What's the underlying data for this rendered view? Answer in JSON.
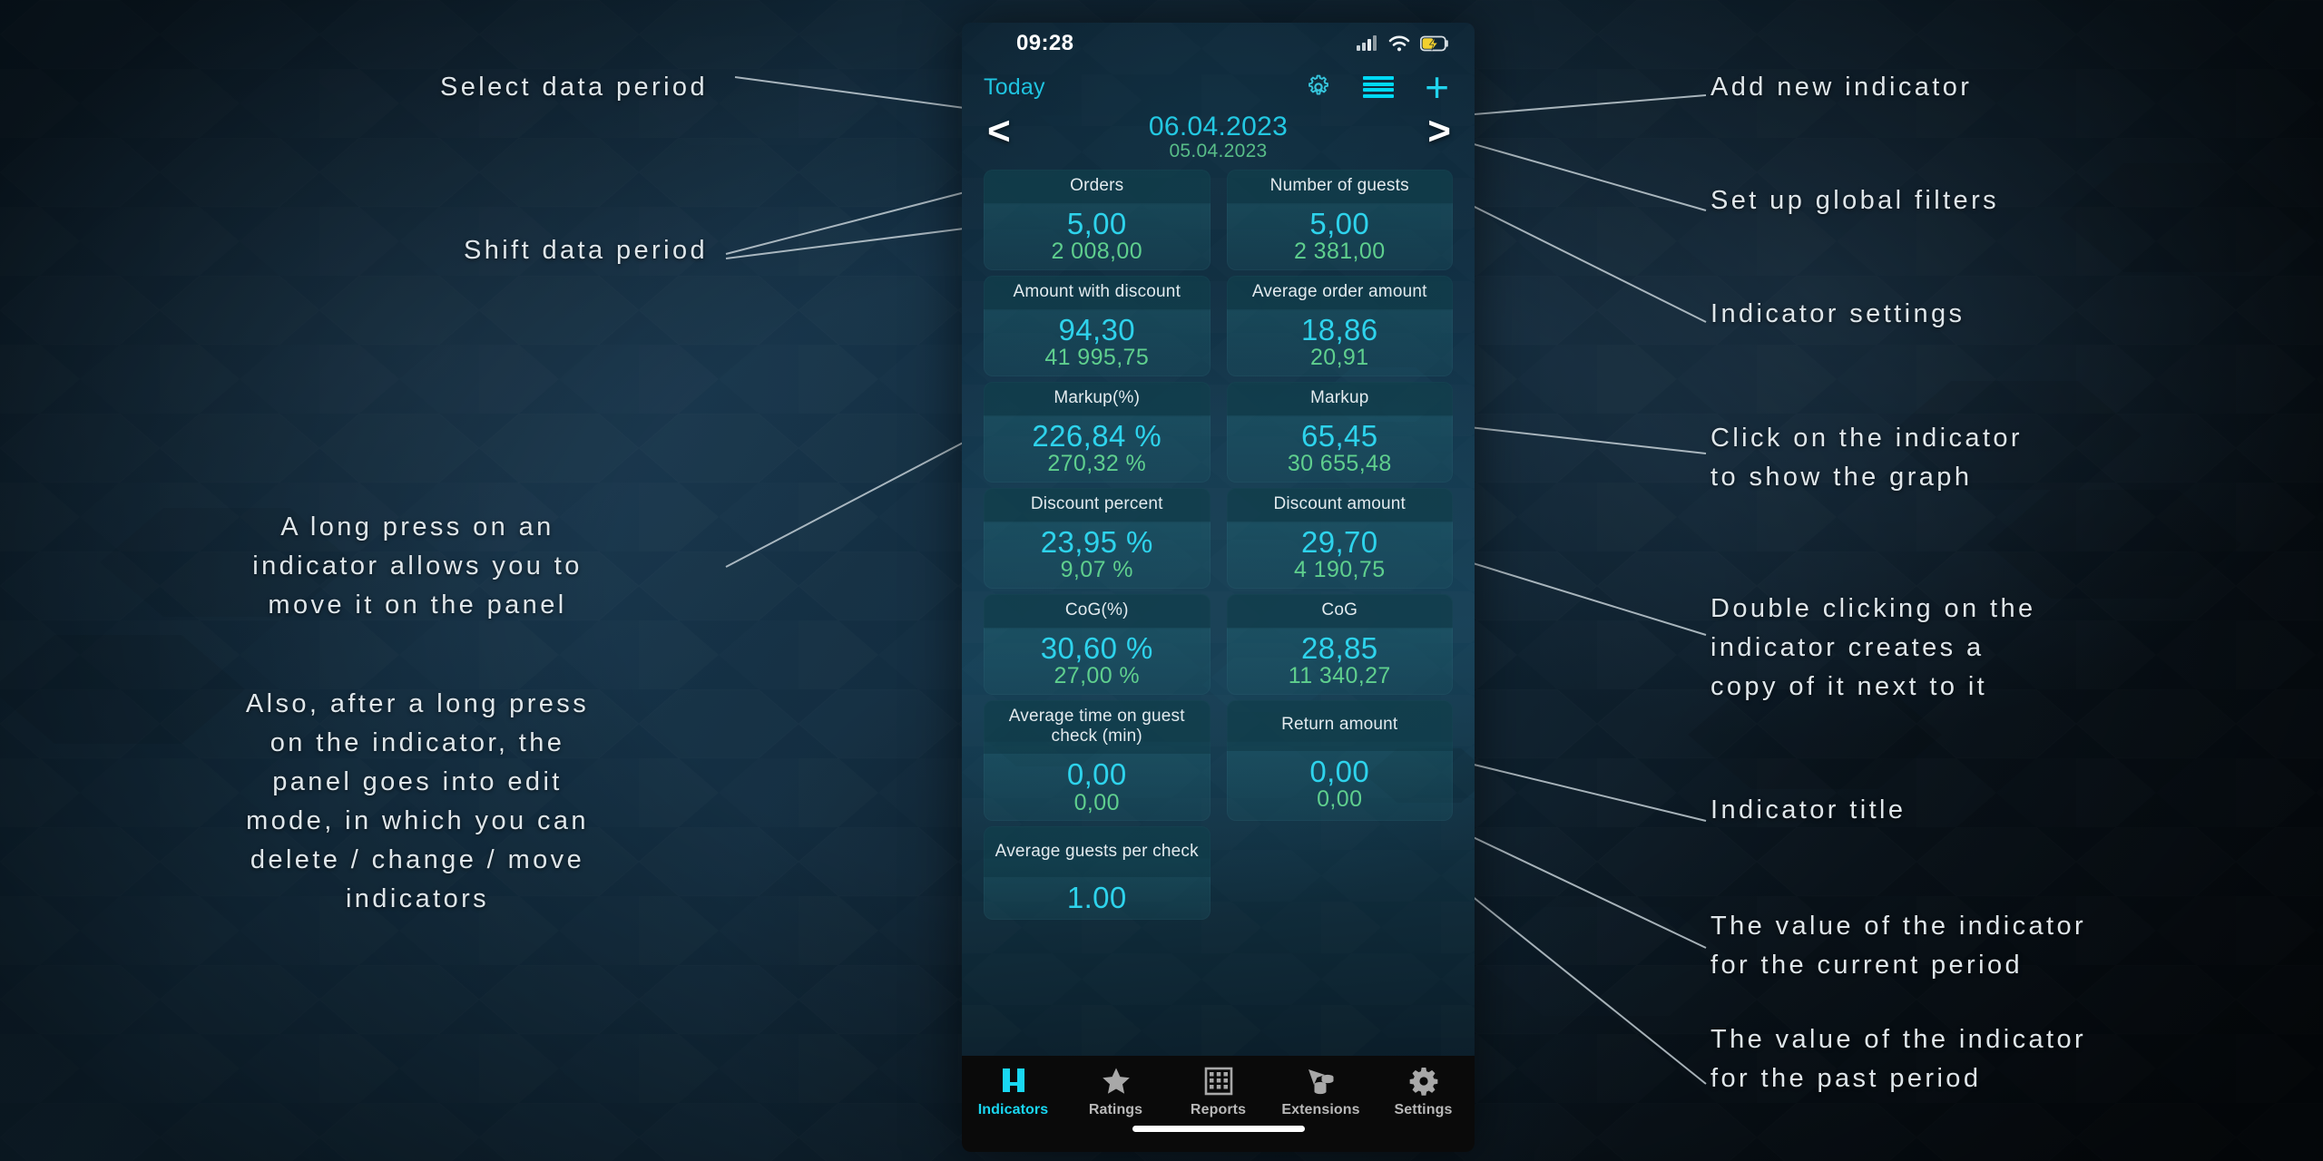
{
  "colors": {
    "accent_cyan": "#2ed3ec",
    "accent_green": "#5fcf8e",
    "today_link": "#1fc4e0",
    "tab_active": "#19d7f2",
    "tab_inactive": "#b9b9b9",
    "card_title": "#e2eaee",
    "annotation": "#dfe6ea",
    "tabbar_bg": "#0a0a0a"
  },
  "status_bar": {
    "time": "09:28",
    "icons": [
      "cellular-signal-icon",
      "wifi-icon",
      "battery-charging-icon"
    ]
  },
  "top_bar": {
    "period_label": "Today",
    "gear_icon": "gear-icon",
    "filter_icon": "filter-lines-icon",
    "add_icon": "plus-icon"
  },
  "date_nav": {
    "prev_arrow": "<",
    "next_arrow": ">",
    "current_date": "06.04.2023",
    "previous_date": "05.04.2023"
  },
  "indicators": [
    {
      "title": "Orders",
      "current": "5,00",
      "previous": "2 008,00",
      "two_line": false
    },
    {
      "title": "Number of guests",
      "current": "5,00",
      "previous": "2 381,00",
      "two_line": false
    },
    {
      "title": "Amount with discount",
      "current": "94,30",
      "previous": "41 995,75",
      "two_line": false
    },
    {
      "title": "Average order amount",
      "current": "18,86",
      "previous": "20,91",
      "two_line": false
    },
    {
      "title": "Markup(%)",
      "current": "226,84 %",
      "previous": "270,32 %",
      "two_line": false
    },
    {
      "title": "Markup",
      "current": "65,45",
      "previous": "30 655,48",
      "two_line": false
    },
    {
      "title": "Discount percent",
      "current": "23,95 %",
      "previous": "9,07 %",
      "two_line": false
    },
    {
      "title": "Discount amount",
      "current": "29,70",
      "previous": "4 190,75",
      "two_line": false
    },
    {
      "title": "CoG(%)",
      "current": "30,60 %",
      "previous": "27,00 %",
      "two_line": false
    },
    {
      "title": "CoG",
      "current": "28,85",
      "previous": "11 340,27",
      "two_line": false
    },
    {
      "title": "Average time on guest check (min)",
      "current": "0,00",
      "previous": "0,00",
      "two_line": true
    },
    {
      "title": "Return amount",
      "current": "0,00",
      "previous": "0,00",
      "two_line": true
    },
    {
      "title": "Average guests per check",
      "current": "1.00",
      "previous": "",
      "two_line": true
    }
  ],
  "tabs": [
    {
      "label": "Indicators",
      "icon": "indicators-icon",
      "active": true
    },
    {
      "label": "Ratings",
      "icon": "star-icon",
      "active": false
    },
    {
      "label": "Reports",
      "icon": "grid-table-icon",
      "active": false
    },
    {
      "label": "Extensions",
      "icon": "plane-coins-icon",
      "active": false
    },
    {
      "label": "Settings",
      "icon": "gear-icon",
      "active": false
    }
  ],
  "annotations": {
    "left": [
      {
        "id": "select-data-period",
        "text": "Select data period"
      },
      {
        "id": "shift-data-period",
        "text": "Shift data period"
      },
      {
        "id": "long-press-move",
        "text": "A long press on an\nindicator allows you to\nmove it on the panel"
      },
      {
        "id": "edit-mode",
        "text": "Also, after a long press\non the indicator, the\npanel goes into edit\nmode, in which you can\ndelete / change / move\nindicators"
      }
    ],
    "right": [
      {
        "id": "add-new-indicator",
        "text": "Add new indicator"
      },
      {
        "id": "global-filters",
        "text": "Set up global filters"
      },
      {
        "id": "indicator-settings",
        "text": "Indicator settings"
      },
      {
        "id": "click-show-graph",
        "text": "Click on the indicator\nto show the graph"
      },
      {
        "id": "double-click-copy",
        "text": "Double clicking on the\nindicator creates a\ncopy of it next to it"
      },
      {
        "id": "indicator-title",
        "text": "Indicator title"
      },
      {
        "id": "value-current",
        "text": "The value of the indicator\nfor the current period"
      },
      {
        "id": "value-past",
        "text": "The value of the indicator\nfor the past period"
      }
    ]
  }
}
